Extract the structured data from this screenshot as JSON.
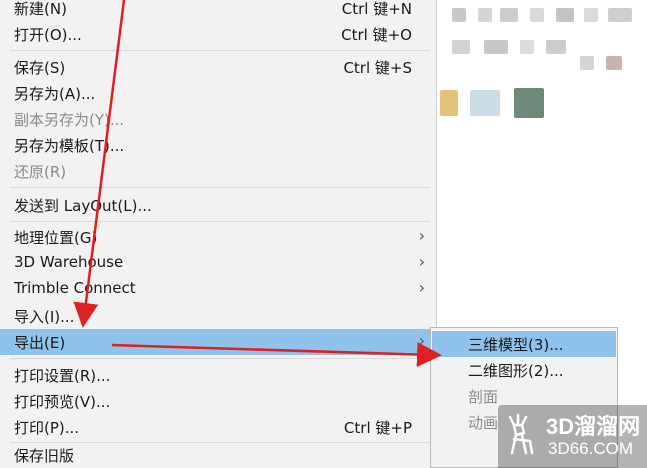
{
  "menu": {
    "items": [
      {
        "label": "新建(N)",
        "shortcut": "Ctrl 键+N"
      },
      {
        "label": "打开(O)...",
        "shortcut": "Ctrl 键+O"
      },
      {
        "label": "保存(S)",
        "shortcut": "Ctrl 键+S"
      },
      {
        "label": "另存为(A)..."
      },
      {
        "label": "副本另存为(Y)..."
      },
      {
        "label": "另存为模板(T)..."
      },
      {
        "label": "还原(R)"
      },
      {
        "label": "发送到 LayOut(L)..."
      },
      {
        "label": "地理位置(G)"
      },
      {
        "label": "3D Warehouse"
      },
      {
        "label": "Trimble Connect"
      },
      {
        "label": "导入(I)..."
      },
      {
        "label": "导出(E)"
      },
      {
        "label": "打印设置(R)..."
      },
      {
        "label": "打印预览(V)..."
      },
      {
        "label": "打印(P)...",
        "shortcut": "Ctrl 键+P"
      },
      {
        "label": "保存旧版"
      }
    ],
    "submenu_arrow": "›"
  },
  "submenu": {
    "items": [
      {
        "label": "三维模型(3)..."
      },
      {
        "label": "二维图形(2)..."
      },
      {
        "label": "剖面"
      },
      {
        "label": "动画"
      }
    ]
  },
  "watermark": {
    "line1": "3D溜溜网",
    "line2": "3D66.COM"
  },
  "colors": {
    "menu_bg": "#f2f2f2",
    "highlight": "#8fc3ec",
    "arrow_red": "#e02020"
  }
}
